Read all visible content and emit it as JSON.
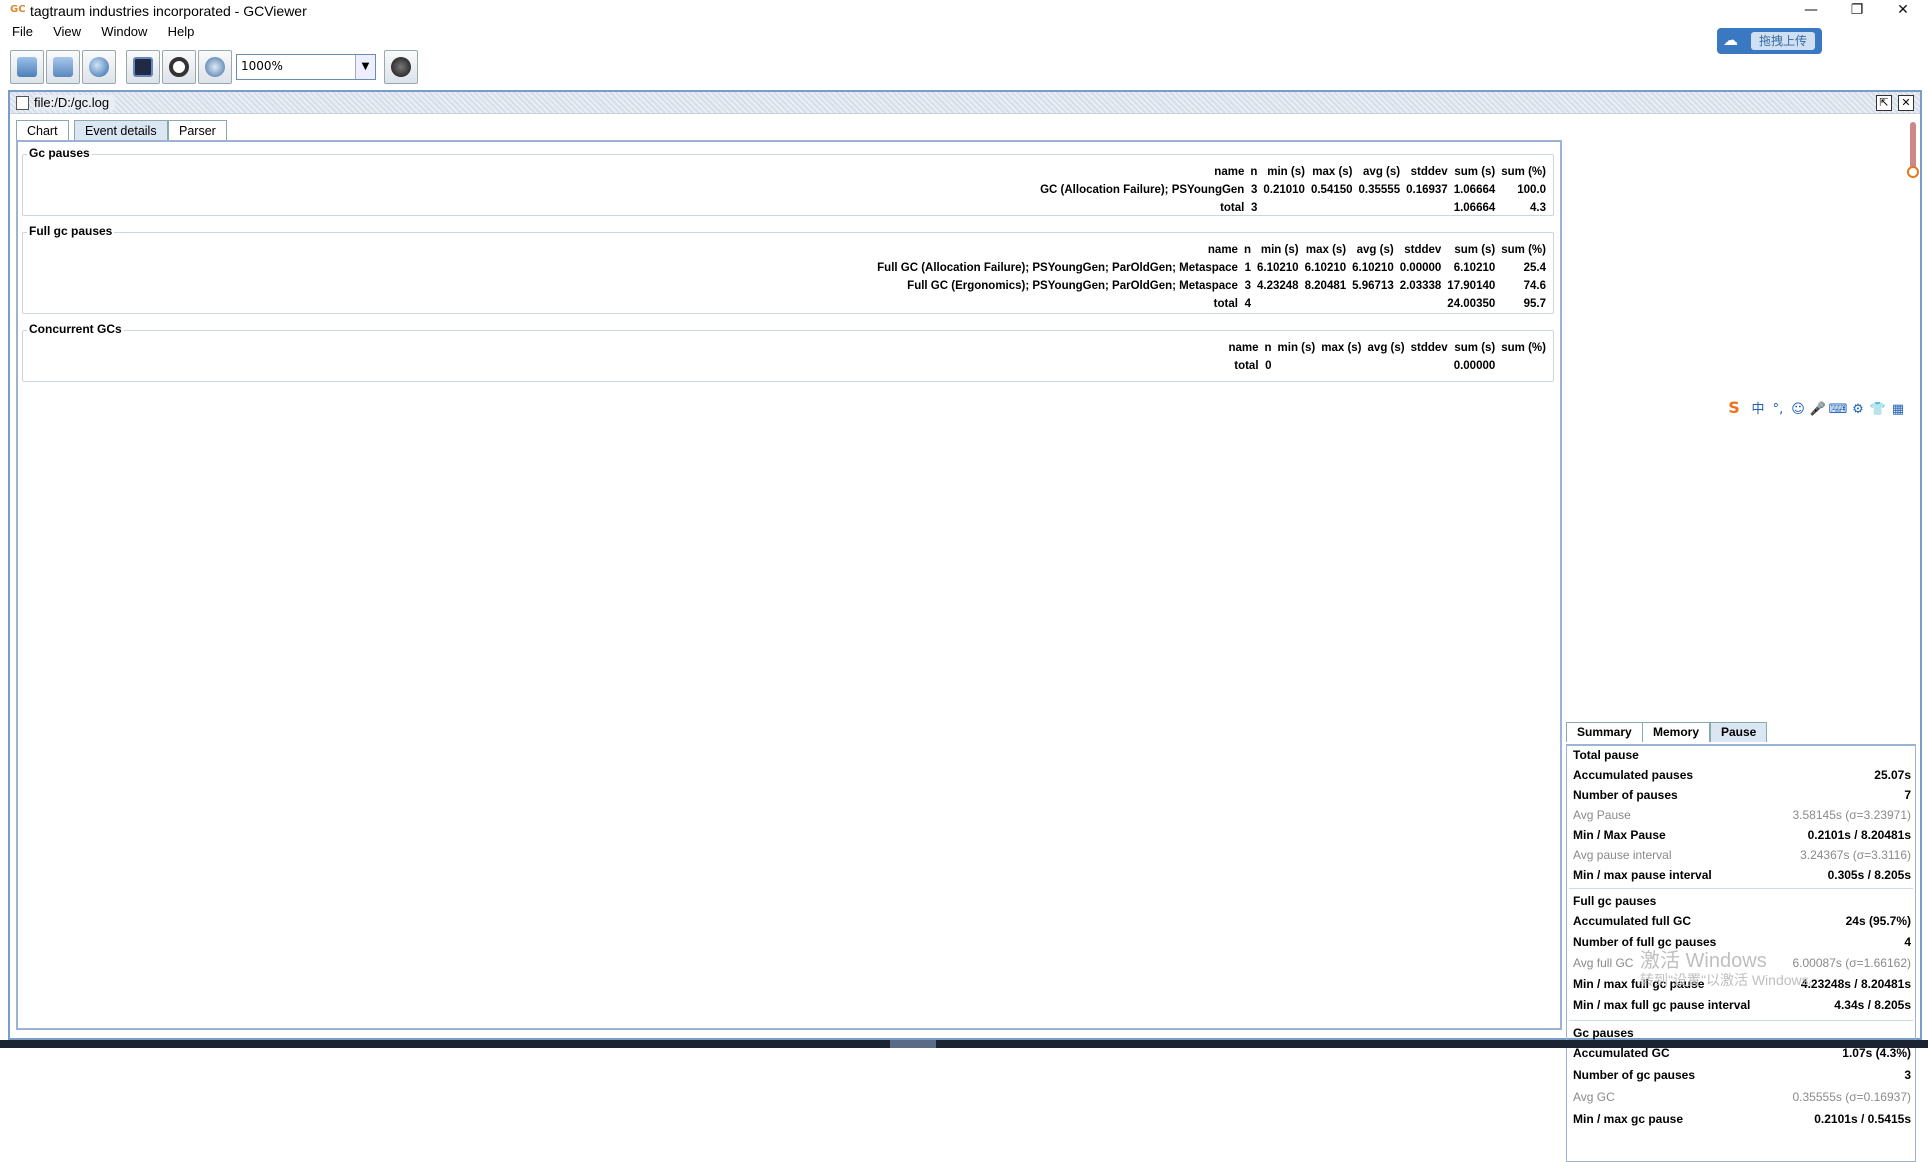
{
  "window": {
    "title": "tagtraum industries incorporated - GCViewer",
    "icon": "GC",
    "buttons": [
      "—",
      "❐",
      "✕"
    ]
  },
  "menu": [
    "File",
    "View",
    "Window",
    "Help"
  ],
  "toolbar": {
    "zoom_value": "1000%",
    "icons": [
      "open-file-icon",
      "open-url-icon",
      "globe-icon",
      "save-icon",
      "refresh-icon",
      "watch-icon",
      "about-icon"
    ]
  },
  "upload_badge": {
    "label": "拖拽上传",
    "icon": "cloud-icon"
  },
  "frame": {
    "title": "file:/D:/gc.log",
    "tabs": [
      "Chart",
      "Event details",
      "Parser"
    ],
    "active_tab": "Event details"
  },
  "gc_pauses": {
    "title": "Gc pauses",
    "headers": [
      "name",
      "n",
      "min (s)",
      "max (s)",
      "avg (s)",
      "stddev",
      "sum (s)",
      "sum (%)"
    ],
    "rows": [
      [
        "GC (Allocation Failure); PSYoungGen",
        "3",
        "0.21010",
        "0.54150",
        "0.35555",
        "0.16937",
        "1.06664",
        "100.0"
      ]
    ],
    "total": [
      "total",
      "3",
      "",
      "",
      "",
      "",
      "1.06664",
      "4.3"
    ]
  },
  "full_gc_pauses": {
    "title": "Full gc pauses",
    "headers": [
      "name",
      "n",
      "min (s)",
      "max (s)",
      "avg (s)",
      "stddev",
      "sum (s)",
      "sum (%)"
    ],
    "rows": [
      [
        "Full GC (Allocation Failure); PSYoungGen; ParOldGen; Metaspace",
        "1",
        "6.10210",
        "6.10210",
        "6.10210",
        "0.00000",
        "6.10210",
        "25.4"
      ],
      [
        "Full GC (Ergonomics); PSYoungGen; ParOldGen; Metaspace",
        "3",
        "4.23248",
        "8.20481",
        "5.96713",
        "2.03338",
        "17.90140",
        "74.6"
      ]
    ],
    "total": [
      "total",
      "4",
      "",
      "",
      "",
      "",
      "24.00350",
      "95.7"
    ]
  },
  "concurrent_gcs": {
    "title": "Concurrent GCs",
    "headers": [
      "name",
      "n",
      "min (s)",
      "max (s)",
      "avg (s)",
      "stddev",
      "sum (s)",
      "sum (%)"
    ],
    "total": [
      "total",
      "0",
      "",
      "",
      "",
      "",
      "0.00000",
      ""
    ]
  },
  "ime_bar": {
    "logo": "S",
    "items": [
      "中",
      "°,",
      "☺",
      "🎤",
      "⌨",
      "⚙",
      "👕",
      "▦"
    ]
  },
  "right_tabs": [
    "Summary",
    "Memory",
    "Pause"
  ],
  "right_active_tab": "Pause",
  "stats": {
    "total_pause": {
      "title": "Total pause",
      "rows": [
        {
          "k": "Accumulated pauses",
          "v": "25.07s",
          "dim": false
        },
        {
          "k": "Number of pauses",
          "v": "7",
          "dim": false
        },
        {
          "k": "Avg Pause",
          "v": "3.58145s (σ=3.23971)",
          "dim": true
        },
        {
          "k": "Min / Max Pause",
          "v": "0.2101s / 8.20481s",
          "dim": false
        },
        {
          "k": "Avg pause interval",
          "v": "3.24367s (σ=3.3116)",
          "dim": true
        },
        {
          "k": "Min / max pause interval",
          "v": "0.305s / 8.205s",
          "dim": false
        }
      ]
    },
    "full_gc_pauses": {
      "title": "Full gc pauses",
      "rows": [
        {
          "k": "Accumulated full GC",
          "v": "24s (95.7%)",
          "dim": false
        },
        {
          "k": "Number of full gc pauses",
          "v": "4",
          "dim": false
        },
        {
          "k": "Avg full GC",
          "v": "6.00087s (σ=1.66162)",
          "dim": true
        },
        {
          "k": "Min / max full gc pause",
          "v": "4.23248s / 8.20481s",
          "dim": false
        },
        {
          "k": "Min / max full gc pause interval",
          "v": "4.34s / 8.205s",
          "dim": false
        }
      ]
    },
    "gc_pauses": {
      "title": "Gc pauses",
      "rows": [
        {
          "k": "Accumulated GC",
          "v": "1.07s (4.3%)",
          "dim": false
        },
        {
          "k": "Number of gc pauses",
          "v": "3",
          "dim": false
        },
        {
          "k": "Avg GC",
          "v": "0.35555s (σ=0.16937)",
          "dim": true
        },
        {
          "k": "Min / max gc pause",
          "v": "0.2101s / 0.5415s",
          "dim": false
        }
      ]
    }
  },
  "watermark": {
    "line1": "激活 Windows",
    "line2": "转到\"设置\"以激活 Windows。"
  }
}
